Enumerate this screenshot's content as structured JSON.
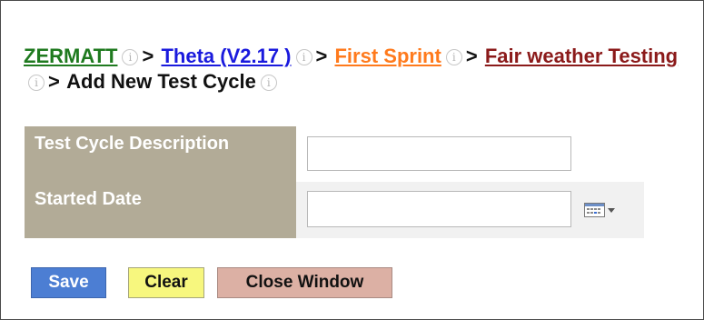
{
  "breadcrumb": {
    "items": [
      {
        "label": "ZERMATT",
        "color": "#1f7a1f"
      },
      {
        "label": "Theta (V2.17 )",
        "color": "#1a1add"
      },
      {
        "label": "First Sprint",
        "color": "#ff7a1c"
      },
      {
        "label": "Fair weather Testing",
        "color": "#8b1a1a"
      }
    ],
    "separator": ">",
    "current": "Add New Test Cycle",
    "info_icon_glyph": "i"
  },
  "form": {
    "fields": [
      {
        "label": "Test Cycle Description",
        "value": "",
        "placeholder": ""
      },
      {
        "label": "Started Date",
        "value": "",
        "placeholder": ""
      }
    ],
    "calendar_icon": "calendar-dropdown-icon"
  },
  "buttons": {
    "save": "Save",
    "clear": "Clear",
    "close": "Close Window"
  },
  "colors": {
    "label_bg": "#b2ab97",
    "save_bg": "#4c7ed3",
    "clear_bg": "#f7f77e",
    "close_bg": "#dcb0a4"
  }
}
